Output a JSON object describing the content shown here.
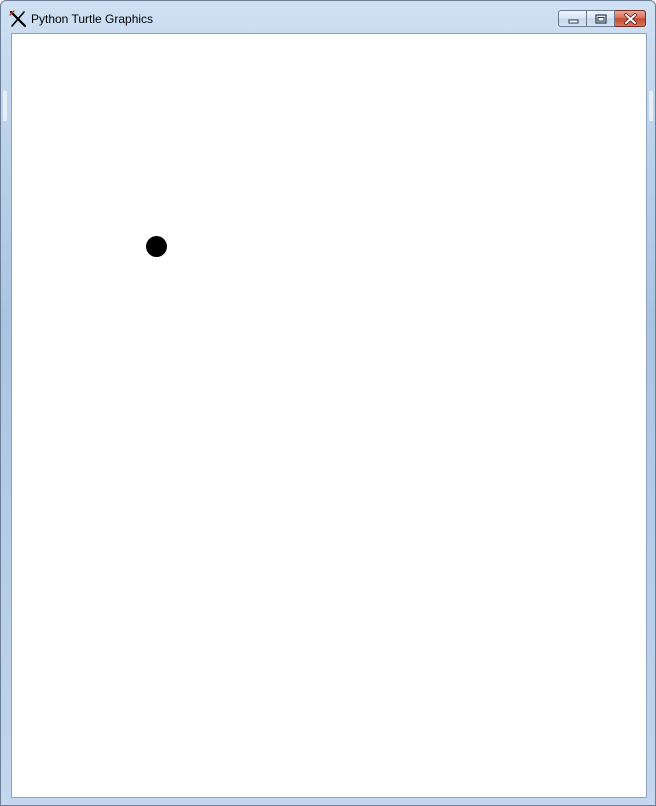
{
  "window": {
    "title": "Python Turtle Graphics",
    "app_icon": "turtle-x-icon",
    "caption_buttons": [
      {
        "name": "minimize",
        "icon": "minimize-icon"
      },
      {
        "name": "maximize",
        "icon": "maximize-icon"
      },
      {
        "name": "close",
        "icon": "close-icon"
      }
    ]
  },
  "canvas": {
    "background": "#ffffff",
    "shapes": [
      {
        "type": "dot",
        "color": "#000000"
      }
    ]
  },
  "colors": {
    "frame": "#b9d1ea",
    "close_button": "#c44a33"
  }
}
